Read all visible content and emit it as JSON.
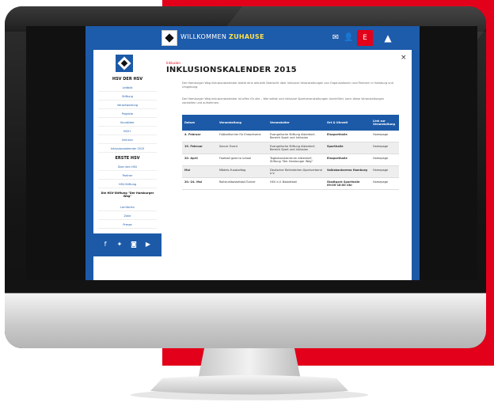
{
  "site": {
    "top_title_plain": "WILLKOMMEN",
    "top_title_bold": "ZUHAUSE",
    "top_icons": [
      "ticket-icon",
      "user-icon"
    ],
    "sponsor_label": "E",
    "partner_glyph": "▲"
  },
  "sidebar": {
    "header": "HSV DER HSV",
    "items": [
      "Leitbild",
      "Stiftung",
      "Verantwortung",
      "Projekte",
      "Kurzbilder",
      "HSV+",
      "Inkluion",
      "Inklusionskalender 2015"
    ],
    "section": "ERSTE HSV",
    "subitems": [
      "Über den HSV",
      "Partner",
      "HSV-Stiftung"
    ],
    "promo": "Die HSV-Stiftung \"Der Hamburger Weg\"",
    "extra": [
      "Lernferien",
      "Zeile",
      "Presse"
    ]
  },
  "content": {
    "close": "×",
    "breadcrumb": "Inklusion",
    "title": "INKLUSIONSKALENDER 2015",
    "para1": "Der Hamburger Weg Inklusionskalender bietet eine aktuelle Übersicht über inklusive Veranstaltungen von Organisationen und Partnern in Hamburg und Umgebung.",
    "para2": "Der Hamburger Weg Inklusionskalender ist offen für alle – Wer selbst und inklusive Sportveranstaltungen durchführt, kann diese Veranstaltungen vorstellen und aufnehmen.",
    "table": {
      "headers": [
        "Datum",
        "Veranstaltung",
        "Veranstalter",
        "Ort & Uhrzeit",
        "Link zur Veranstaltung"
      ],
      "rows": [
        [
          "4. Februar",
          "Fußballturnier für Erwachsene",
          "Evangelische Stiftung Alsterdorf, Bereich Sport und Inklusion",
          "Eissporthalle",
          "Homepage"
        ],
        [
          "19. Februar",
          "Soccer Event",
          "Evangelische Stiftung Alsterdorf, Bereich Sport und Inklusion",
          "Sporthalle",
          "Homepage"
        ],
        [
          "20. April",
          "Football goes to school",
          "Tageskunstzentrum Alsterdorf, Stiftung \"Der Hamburger Weg\"",
          "Eissporthalle",
          "Homepage"
        ],
        [
          "Mai",
          "Mädels-Fussballtag",
          "Deutscher Behinderten-Sportverband e.V.",
          "Volksbankarena Hamburg",
          "Homepage"
        ],
        [
          "20.-24. Mai",
          "Rollstuhlbasketball-Turnier",
          "HSV e.V. Basketball",
          "Stadtpark Sporthalle 09:00-18:00 Uhr",
          "Homepage"
        ]
      ]
    }
  }
}
